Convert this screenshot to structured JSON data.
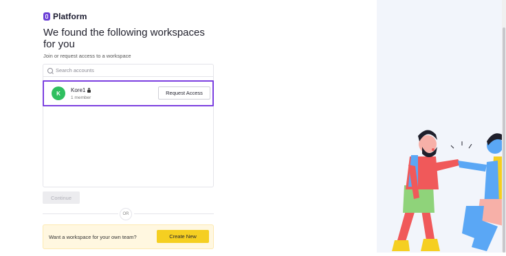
{
  "brand": {
    "name": "Platform",
    "accent": "#6b3fd6"
  },
  "page": {
    "title": "We found the following workspaces for you",
    "subtitle": "Join or request access to a workspace"
  },
  "search": {
    "placeholder": "Search accounts",
    "value": "",
    "icon": "search-icon"
  },
  "workspaces": [
    {
      "initial": "K",
      "name": "Kore1",
      "locked": true,
      "members": "1 member",
      "action_label": "Request Access",
      "avatar_color": "#2fbf5f",
      "selected": true
    }
  ],
  "continue_label": "Continue",
  "divider_label": "OR",
  "banner": {
    "text": "Want a workspace for your own team?",
    "button_label": "Create New",
    "button_color": "#f5cf21"
  },
  "selection_color": "#7b3fe0"
}
